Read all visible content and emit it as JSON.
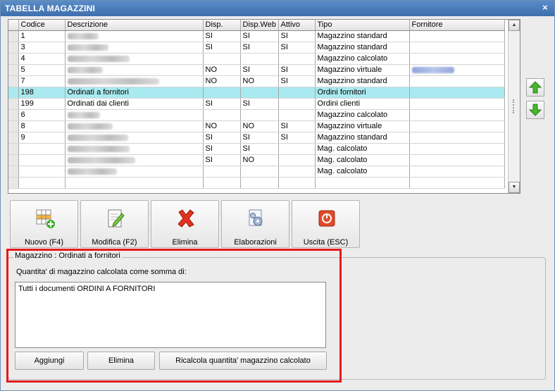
{
  "window": {
    "title": "TABELLA MAGAZZINI",
    "close_glyph": "×"
  },
  "grid": {
    "columns": [
      "Codice",
      "Descrizione",
      "Disp.",
      "Disp.Web",
      "Attivo",
      "Tipo",
      "Fornitore"
    ],
    "rows": [
      {
        "codice": "1",
        "descrizione": "",
        "disp": "SI",
        "web": "SI",
        "attivo": "SI",
        "tipo": "Magazzino standard",
        "fornitore": "",
        "blur_desc": true
      },
      {
        "codice": "3",
        "descrizione": "",
        "disp": "SI",
        "web": "SI",
        "attivo": "SI",
        "tipo": "Magazzino standard",
        "fornitore": "",
        "blur_desc": true
      },
      {
        "codice": "4",
        "descrizione": "",
        "disp": "",
        "web": "",
        "attivo": "",
        "tipo": "Magazzino calcolato",
        "fornitore": "",
        "blur_desc": true
      },
      {
        "codice": "5",
        "descrizione": "",
        "disp": "NO",
        "web": "SI",
        "attivo": "SI",
        "tipo": "Magazzino virtuale",
        "fornitore": "",
        "blur_desc": true,
        "blur_forn": true
      },
      {
        "codice": "7",
        "descrizione": "",
        "disp": "NO",
        "web": "NO",
        "attivo": "SI",
        "tipo": "Magazzino standard",
        "fornitore": "",
        "blur_desc": true
      },
      {
        "codice": "198",
        "descrizione": "Ordinati a fornitori",
        "disp": "",
        "web": "",
        "attivo": "",
        "tipo": "Ordini fornitori",
        "fornitore": "",
        "selected": true
      },
      {
        "codice": "199",
        "descrizione": "Ordinati dai clienti",
        "disp": "SI",
        "web": "SI",
        "attivo": "",
        "tipo": "Ordini clienti",
        "fornitore": ""
      },
      {
        "codice": "6",
        "descrizione": "",
        "disp": "",
        "web": "",
        "attivo": "",
        "tipo": "Magazzino calcolato",
        "fornitore": "",
        "blur_desc": true
      },
      {
        "codice": "8",
        "descrizione": "",
        "disp": "NO",
        "web": "NO",
        "attivo": "SI",
        "tipo": "Magazzino virtuale",
        "fornitore": "",
        "blur_desc": true
      },
      {
        "codice": "9",
        "descrizione": "",
        "disp": "SI",
        "web": "SI",
        "attivo": "SI",
        "tipo": "Magazzino standard",
        "fornitore": "",
        "blur_desc": true
      },
      {
        "codice": "",
        "descrizione": "",
        "disp": "SI",
        "web": "SI",
        "attivo": "",
        "tipo": "Mag. calcolato",
        "fornitore": "",
        "blur_desc": true
      },
      {
        "codice": "",
        "descrizione": "",
        "disp": "SI",
        "web": "NO",
        "attivo": "",
        "tipo": "Mag. calcolato",
        "fornitore": "",
        "blur_desc": true
      },
      {
        "codice": "",
        "descrizione": "",
        "disp": "",
        "web": "",
        "attivo": "",
        "tipo": "Mag. calcolato",
        "fornitore": "",
        "blur_desc": true
      }
    ],
    "selection_color": "#a9eaf0"
  },
  "toolbar": {
    "nuovo": "Nuovo (F4)",
    "modifica": "Modifica (F2)",
    "elimina": "Elimina",
    "elaborazioni": "Elaborazioni",
    "uscita": "Uscita (ESC)"
  },
  "panel": {
    "legend": "Magazzino : Ordinati a fornitori",
    "qty_label": "Quantita' di magazzino calcolata come somma di:",
    "text": "Tutti i documenti ORDINI A FORNITORI",
    "aggiungi": "Aggiungi",
    "elimina": "Elimina",
    "ricalcola": "Ricalcola quantita' magazzino calcolato",
    "highlight_color": "#e51b1b"
  }
}
